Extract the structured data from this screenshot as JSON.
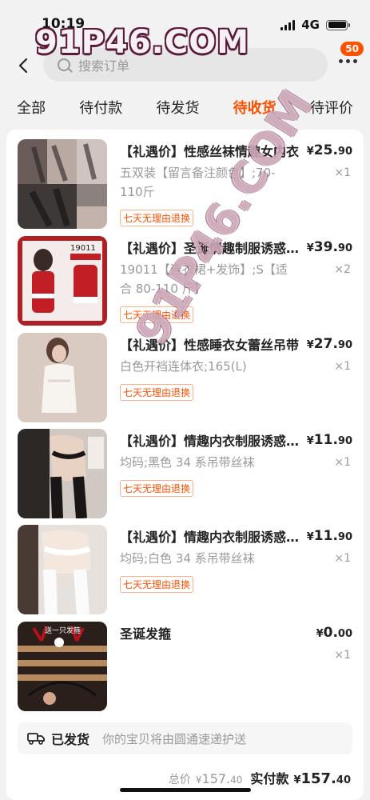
{
  "status_bar": {
    "time": "10:19",
    "network": "4G"
  },
  "watermark": {
    "text": "91P46.COM"
  },
  "nav": {
    "search_placeholder": "搜索订单",
    "badge_count": "50"
  },
  "tabs": [
    "全部",
    "待付款",
    "待发货",
    "待收货",
    "待评价"
  ],
  "active_tab": "待收货",
  "items": [
    {
      "title": "【礼遇价】性感丝袜情趣女内衣",
      "sku": "五双装【留言备注颜色】;70-110斤",
      "tag": "七天无理由退换",
      "currency": "¥",
      "price_int": "25.",
      "price_dec": "90",
      "qty": "×1",
      "thumb_icon": "stockings-product-image"
    },
    {
      "title": "【礼遇价】圣诞情趣制服诱惑套装",
      "sku": "19011【连衣裙+发饰】;S【适合 80-110 斤】",
      "tag": "七天无理由退换",
      "currency": "¥",
      "price_int": "39.",
      "price_dec": "90",
      "qty": "×2",
      "thumb_icon": "christmas-costume-product-image",
      "thumb_label": "19011"
    },
    {
      "title": "【礼遇价】性感睡衣女蕾丝吊带",
      "sku": "白色开裆连体衣;165(L)",
      "tag": "七天无理由退换",
      "currency": "¥",
      "price_int": "27.",
      "price_dec": "90",
      "qty": "×1",
      "thumb_icon": "lace-sleepwear-product-image"
    },
    {
      "title": "【礼遇价】情趣内衣制服诱惑套装",
      "sku": "均码;黑色 34 系吊带丝袜",
      "tag": "七天无理由退换",
      "currency": "¥",
      "price_int": "11.",
      "price_dec": "90",
      "qty": "×1",
      "thumb_icon": "black-garter-product-image"
    },
    {
      "title": "【礼遇价】情趣内衣制服诱惑套装",
      "sku": "均码;白色 34 系吊带丝袜",
      "tag": "七天无理由退换",
      "currency": "¥",
      "price_int": "11.",
      "price_dec": "90",
      "qty": "×1",
      "thumb_icon": "white-garter-product-image"
    },
    {
      "title": "圣诞发箍",
      "sku": "",
      "tag": "",
      "currency": "¥",
      "price_int": "0.",
      "price_dec": "00",
      "qty": "×1",
      "thumb_icon": "christmas-headband-product-image",
      "thumb_label": "送一只发箍"
    }
  ],
  "shipping": {
    "status": "已发货",
    "desc": "你的宝贝将由圆通速递护送"
  },
  "totals": {
    "total_label": "总价",
    "total_currency": "¥",
    "total_int": "157.",
    "total_dec": "40",
    "paid_label": "实付款",
    "paid_currency": "¥",
    "paid_int": "157.",
    "paid_dec": "40"
  },
  "colors": {
    "accent": "#ff5000",
    "background": "#f2f2f2"
  }
}
